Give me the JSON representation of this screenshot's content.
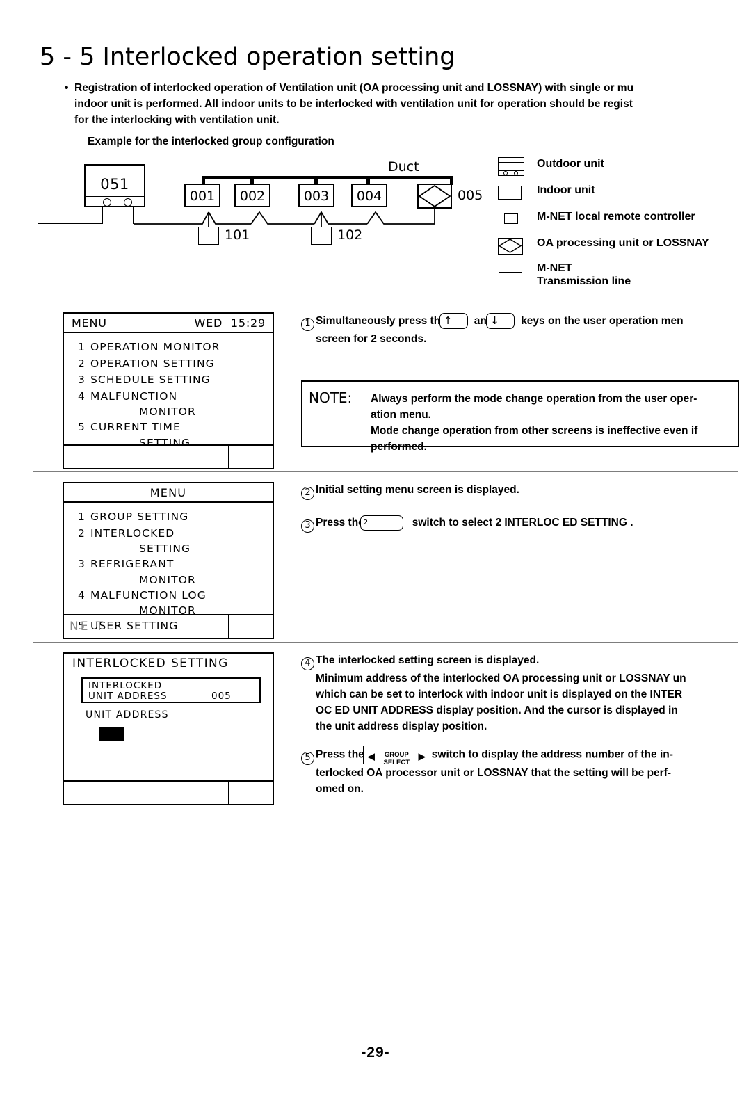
{
  "title": "5 - 5 Interlocked operation setting",
  "intro": {
    "line1": "Registration of interlocked operation of Ventilation unit (OA processing unit and LOSSNAY) with single or mu",
    "line2": "indoor unit is performed. All indoor units to be interlocked with ventilation unit for operation should be regist",
    "line3": "for the interlocking with ventilation unit.",
    "example_heading": "Example for the interlocked group configuration"
  },
  "diagram": {
    "outdoor_unit": "051",
    "indoor_units": [
      "001",
      "002",
      "003",
      "004"
    ],
    "oa_unit": "005",
    "remote_controllers": [
      "101",
      "102"
    ],
    "duct_label": "Duct"
  },
  "legend": {
    "items": [
      {
        "icon": "outdoor-unit-icon",
        "label": "Outdoor unit"
      },
      {
        "icon": "indoor-unit-icon",
        "label": "Indoor unit"
      },
      {
        "icon": "remote-controller-icon",
        "label": "M-NET local remote controller"
      },
      {
        "icon": "oa-processing-unit-icon",
        "label": "OA processing unit or LOSSNAY"
      },
      {
        "icon": "transmission-line-icon",
        "label_line1": "M-NET",
        "label_line2": "Transmission line"
      }
    ]
  },
  "screen1": {
    "header_left": "MENU",
    "header_day": "WED",
    "header_time": "15:29",
    "items": [
      {
        "num": "1",
        "text": "OPERATION MONITOR",
        "sub": ""
      },
      {
        "num": "2",
        "text": "OPERATION SETTING",
        "sub": ""
      },
      {
        "num": "3",
        "text": "SCHEDULE SETTING",
        "sub": ""
      },
      {
        "num": "4",
        "text": "MALFUNCTION",
        "sub": "MONITOR"
      },
      {
        "num": "5",
        "text": "CURRENT TIME",
        "sub": "SETTING"
      }
    ],
    "footer_label": ""
  },
  "screen2": {
    "header_center": "MENU",
    "items": [
      {
        "num": "1",
        "text": "GROUP SETTING",
        "sub": ""
      },
      {
        "num": "2",
        "text": "INTERLOCKED",
        "sub": "SETTING"
      },
      {
        "num": "3",
        "text": "REFRIGERANT",
        "sub": "MONITOR"
      },
      {
        "num": "4",
        "text": "MALFUNCTION LOG",
        "sub": "MONITOR"
      },
      {
        "num": "5",
        "text": "USER SETTING",
        "sub": ""
      }
    ],
    "footer_label": "NE T"
  },
  "screen3": {
    "title": "INTERLOCKED  SETTING",
    "box_line1": "INTERLOCKED",
    "box_line2": "UNIT ADDRESS",
    "box_value": "005",
    "unit_address_label": "UNIT ADDRESS"
  },
  "steps": {
    "s1": {
      "num": "1",
      "pre": "Simultaneously press the",
      "key1": "↑",
      "mid": "and",
      "key2": "↓",
      "post": "keys on the user operation men",
      "line2": "screen for 2 seconds."
    },
    "s2": {
      "num": "2",
      "text": "Initial setting menu screen is displayed."
    },
    "s3": {
      "num": "3",
      "pre": "Press the",
      "key_label": "2",
      "post": "switch to select  2 INTERLOC  ED SETTING  ."
    },
    "s4": {
      "num": "4",
      "line1": "The interlocked setting screen is displayed.",
      "line2": "Minimum address of the interlocked OA processing unit or LOSSNAY un",
      "line3": "which can be set to interlock with indoor unit is displayed on the  INTER",
      "line4": "OC  ED UNIT ADDRESS  display position. And the cursor is displayed in",
      "line5": "the unit address display position."
    },
    "s5": {
      "num": "5",
      "pre": "Press the",
      "btn_line1": "GROUP",
      "btn_line2": "SELECT",
      "btn_arrow_left": "◀",
      "btn_arrow_right": "▶",
      "post": "switch to display the address number of the in-",
      "line2": "terlocked OA processor unit or LOSSNAY that the setting will be perf-",
      "line3": "omed on."
    }
  },
  "note": {
    "label": "NOTE:",
    "line1": "Always perform the mode change operation from the user oper-",
    "line2": "ation menu.",
    "line3": "Mode change operation from other screens is ineffective even if",
    "line4": "performed."
  },
  "page_number": "-29-"
}
